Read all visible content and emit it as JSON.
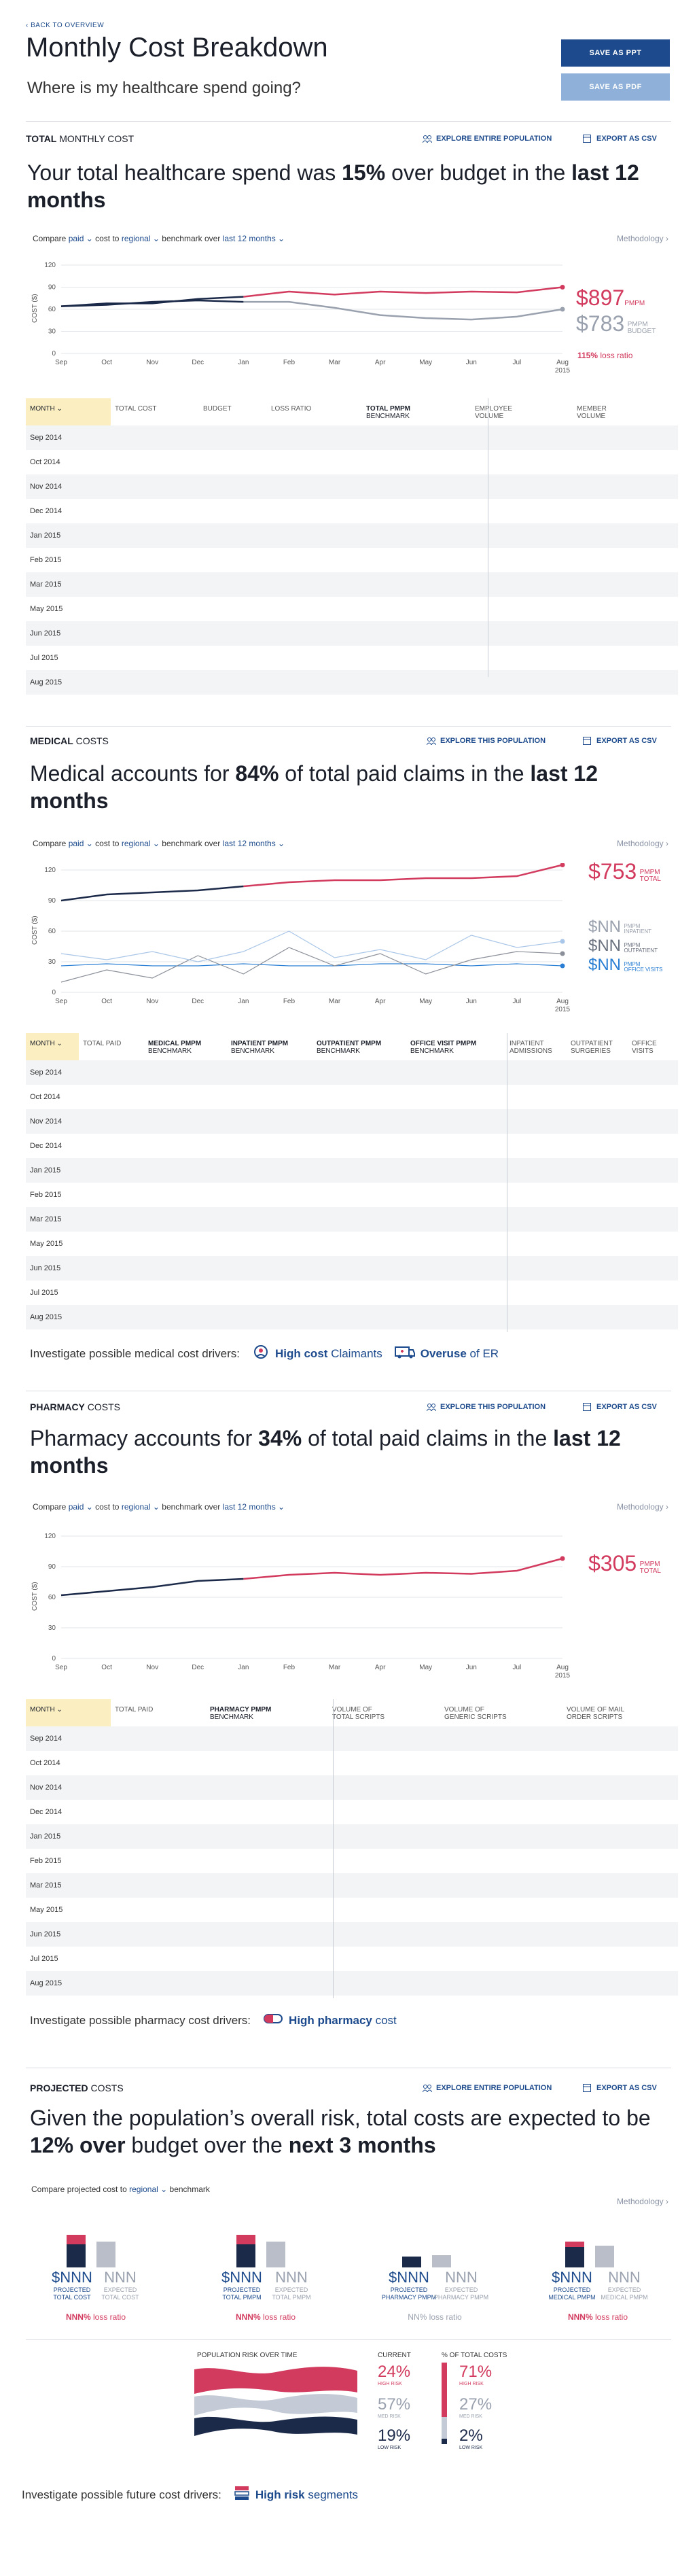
{
  "header": {
    "back_link": "BACK TO OVERVIEW",
    "title": "Monthly Cost Breakdown",
    "subtitle": "Where is my healthcare spend going?",
    "save_ppt": "SAVE AS PPT",
    "save_pdf": "SAVE AS PDF"
  },
  "colors": {
    "accent_red": "#d23a5e",
    "navy": "#1c2a4a",
    "link_blue": "#1c4a8c",
    "button_blue": "#1c4a8c",
    "button_light": "#8fb0d8",
    "month_header": "#fbeec0"
  },
  "months_axis": [
    "Sep",
    "Oct",
    "Nov",
    "Dec",
    "Jan",
    "Feb",
    "Mar",
    "Apr",
    "May",
    "Jun",
    "Jul",
    "Aug"
  ],
  "axis_year": "2015",
  "rows": [
    "Sep 2014",
    "Oct 2014",
    "Nov 2014",
    "Dec 2014",
    "Jan 2015",
    "Feb 2015",
    "Mar 2015",
    "May 2015",
    "Jun 2015",
    "Jul 2015",
    "Aug 2015"
  ],
  "total": {
    "label_bold": "TOTAL",
    "label_rest": "MONTHLY COST",
    "explore": "EXPLORE ENTIRE POPULATION",
    "export": "EXPORT AS CSV",
    "headline_1": "Your total healthcare spend was ",
    "headline_b1": "15%",
    "headline_2": " over budget in the ",
    "headline_b2": "last 12 months",
    "compare": {
      "c1": "Compare",
      "v1": "paid",
      "c2": "cost to",
      "v2": "regional",
      "c3": "benchmark over",
      "v3": "last 12 months"
    },
    "methodology": "Methodology",
    "ylabel": "COST ($)",
    "yticks": [
      "120",
      "90",
      "60",
      "30",
      "0"
    ],
    "value_main": "$897",
    "value_main_unit": "PMPM",
    "value_budget": "$783",
    "value_budget_unit1": "PMPM",
    "value_budget_unit2": "BUDGET",
    "loss_ratio_pct": "115%",
    "loss_ratio_text": "loss ratio",
    "columns": [
      "MONTH",
      "TOTAL COST",
      "BUDGET",
      "LOSS RATIO",
      "TOTAL PMPM",
      "BENCHMARK",
      "EMPLOYEE",
      "VOLUME",
      "MEMBER",
      "VOLUME"
    ]
  },
  "medical": {
    "label_bold": "MEDICAL",
    "label_rest": "COSTS",
    "explore": "EXPLORE THIS POPULATION",
    "export": "EXPORT AS CSV",
    "headline_1": "Medical accounts for ",
    "headline_b1": "84%",
    "headline_2": " of total paid claims in the ",
    "headline_b2": "last 12 months",
    "compare": {
      "c1": "Compare",
      "v1": "paid",
      "c2": "cost to",
      "v2": "regional",
      "c3": "benchmark over",
      "v3": "last 12 months"
    },
    "methodology": "Methodology",
    "ylabel": "COST ($)",
    "yticks": [
      "120",
      "90",
      "60",
      "30",
      "0"
    ],
    "value_main": "$753",
    "value_main_unit1": "PMPM",
    "value_main_unit2": "TOTAL",
    "sub_values": [
      {
        "value": "$NN",
        "unit1": "PMPM",
        "unit2": "INPATIENT"
      },
      {
        "value": "$NN",
        "unit1": "PMPM",
        "unit2": "OUTPATIENT"
      },
      {
        "value": "$NN",
        "unit1": "PMPM",
        "unit2": "OFFICE VISITS"
      }
    ],
    "columns": [
      "MONTH",
      "TOTAL PAID",
      "MEDICAL PMPM",
      "BENCHMARK",
      "INPATIENT PMPM",
      "BENCHMARK",
      "OUTPATIENT PMPM",
      "BENCHMARK",
      "OFFICE VISIT PMPM",
      "BENCHMARK",
      "INPATIENT",
      "ADMISSIONS",
      "OUTPATIENT",
      "SURGERIES",
      "OFFICE",
      "VISITS"
    ],
    "drivers_text": "Investigate possible medical cost drivers:",
    "driver1_b": "High cost",
    "driver1_r": "Claimants",
    "driver2_b": "Overuse",
    "driver2_r": "of ER"
  },
  "pharmacy": {
    "label_bold": "PHARMACY",
    "label_rest": "COSTS",
    "explore": "EXPLORE THIS POPULATION",
    "export": "EXPORT AS CSV",
    "headline_1": "Pharmacy accounts for ",
    "headline_b1": "34%",
    "headline_2": " of total paid claims in the ",
    "headline_b2": "last 12 months",
    "compare": {
      "c1": "Compare",
      "v1": "paid",
      "c2": "cost to",
      "v2": "regional",
      "c3": "benchmark over",
      "v3": "last 12 months"
    },
    "methodology": "Methodology",
    "ylabel": "COST ($)",
    "yticks": [
      "120",
      "90",
      "60",
      "30",
      "0"
    ],
    "value_main": "$305",
    "value_main_unit1": "PMPM",
    "value_main_unit2": "TOTAL",
    "columns": [
      "MONTH",
      "TOTAL PAID",
      "PHARMACY PMPM",
      "BENCHMARK",
      "VOLUME OF",
      "TOTAL SCRIPTS",
      "VOLUME OF",
      "GENERIC SCRIPTS",
      "VOLUME OF MAIL",
      "ORDER SCRIPTS"
    ],
    "drivers_text": "Investigate possible pharmacy cost drivers:",
    "driver1_b": "High pharmacy",
    "driver1_r": "cost"
  },
  "projected": {
    "label_bold": "PROJECTED",
    "label_rest": "COSTS",
    "explore": "EXPLORE ENTIRE POPULATION",
    "export": "EXPORT AS CSV",
    "headline_1": "Given the population’s overall risk, total costs are expected to be ",
    "headline_b1": "12% over",
    "headline_2": " budget over the ",
    "headline_b2": "next 3 months",
    "compare": {
      "c1": "Compare projected cost to",
      "v1": "regional",
      "c2": "benchmark"
    },
    "methodology": "Methodology",
    "kpis": [
      {
        "proj_value": "$NNN",
        "proj_label1": "PROJECTED",
        "proj_label2": "TOTAL COST",
        "exp_value": "NNN",
        "exp_label1": "EXPECTED",
        "exp_label2": "TOTAL COST",
        "ratio": "NNN%",
        "ratio_text": "loss ratio",
        "red": true
      },
      {
        "proj_value": "$NNN",
        "proj_label1": "PROJECTED",
        "proj_label2": "TOTAL PMPM",
        "exp_value": "NNN",
        "exp_label1": "EXPECTED",
        "exp_label2": "TOTAL PMPM",
        "ratio": "NNN%",
        "ratio_text": "loss ratio",
        "red": true
      },
      {
        "proj_value": "$NNN",
        "proj_label1": "PROJECTED",
        "proj_label2": "PHARMACY PMPM",
        "exp_value": "NNN",
        "exp_label1": "EXPECTED",
        "exp_label2": "PHARMACY PMPM",
        "ratio": "NN%",
        "ratio_text": "loss ratio",
        "red": false
      },
      {
        "proj_value": "$NNN",
        "proj_label1": "PROJECTED",
        "proj_label2": "MEDICAL PMPM",
        "exp_value": "NNN",
        "exp_label1": "EXPECTED",
        "exp_label2": "MEDICAL PMPM",
        "ratio": "NNN%",
        "ratio_text": "loss ratio",
        "red": true
      }
    ],
    "risk_title": "POPULATION RISK OVER TIME",
    "current_title": "CURRENT",
    "pct_title": "% OF TOTAL COSTS",
    "risk_rows": [
      {
        "current": "24%",
        "label": "HIGH RISK",
        "pct": "71%"
      },
      {
        "current": "57%",
        "label": "MED RISK",
        "pct": "27%"
      },
      {
        "current": "19%",
        "label": "LOW RISK",
        "pct": "2%"
      }
    ],
    "drivers_text": "Investigate possible future cost drivers:",
    "driver1_b": "High risk",
    "driver1_r": "segments"
  },
  "chart_data": [
    {
      "type": "line",
      "title": "",
      "ylabel": "COST ($)",
      "x": [
        "Sep",
        "Oct",
        "Nov",
        "Dec",
        "Jan",
        "Feb",
        "Mar",
        "Apr",
        "May",
        "Jun",
        "Jul",
        "Aug"
      ],
      "ylim": [
        0,
        120
      ],
      "series": [
        {
          "name": "PMPM",
          "values": [
            64,
            68,
            68,
            74,
            77,
            84,
            80,
            84,
            82,
            84,
            83,
            90
          ]
        },
        {
          "name": "PMPM BUDGET",
          "values": [
            64,
            66,
            70,
            72,
            70,
            70,
            62,
            52,
            48,
            46,
            50,
            60
          ]
        }
      ]
    },
    {
      "type": "line",
      "title": "",
      "ylabel": "COST ($)",
      "x": [
        "Sep",
        "Oct",
        "Nov",
        "Dec",
        "Jan",
        "Feb",
        "Mar",
        "Apr",
        "May",
        "Jun",
        "Jul",
        "Aug"
      ],
      "ylim": [
        0,
        120
      ],
      "series": [
        {
          "name": "PMPM TOTAL",
          "values": [
            90,
            96,
            98,
            100,
            104,
            108,
            110,
            110,
            112,
            112,
            114,
            125
          ]
        },
        {
          "name": "PMPM INPATIENT",
          "values": [
            38,
            32,
            40,
            30,
            40,
            60,
            34,
            42,
            32,
            56,
            44,
            50
          ]
        },
        {
          "name": "PMPM OUTPATIENT",
          "values": [
            10,
            22,
            14,
            36,
            18,
            44,
            26,
            38,
            18,
            32,
            40,
            38
          ]
        },
        {
          "name": "PMPM OFFICE VISITS",
          "values": [
            26,
            28,
            26,
            26,
            28,
            26,
            26,
            28,
            28,
            26,
            28,
            26
          ]
        }
      ]
    },
    {
      "type": "line",
      "title": "",
      "ylabel": "COST ($)",
      "x": [
        "Sep",
        "Oct",
        "Nov",
        "Dec",
        "Jan",
        "Feb",
        "Mar",
        "Apr",
        "May",
        "Jun",
        "Jul",
        "Aug"
      ],
      "ylim": [
        0,
        120
      ],
      "series": [
        {
          "name": "PMPM TOTAL",
          "values": [
            62,
            66,
            70,
            76,
            78,
            82,
            84,
            82,
            84,
            83,
            86,
            98
          ]
        }
      ]
    }
  ]
}
